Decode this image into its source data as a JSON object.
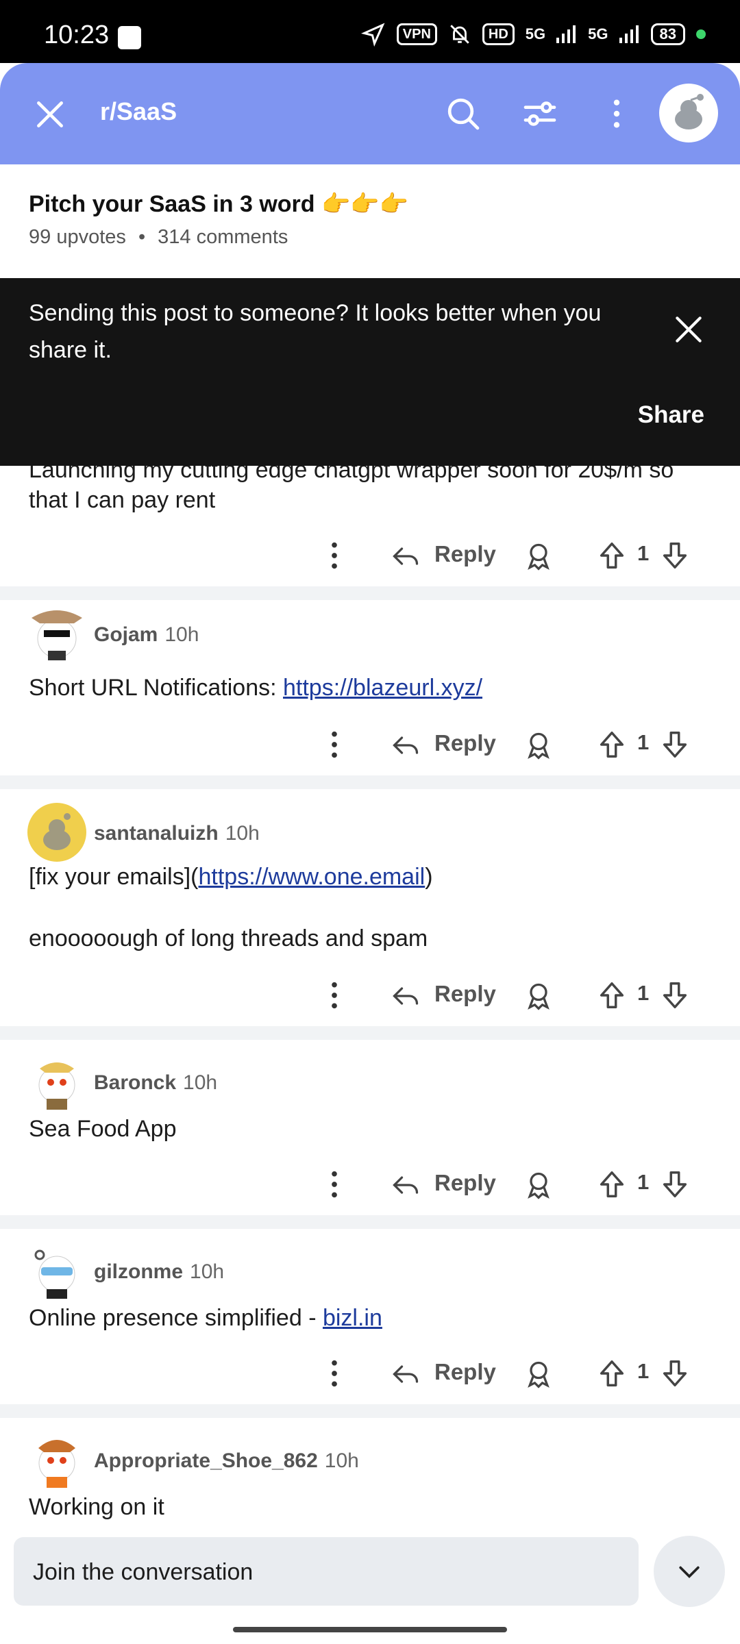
{
  "status_bar": {
    "time": "10:23",
    "vpn": "VPN",
    "hd": "HD",
    "net1": "5G",
    "net2": "5G",
    "battery": "83"
  },
  "header": {
    "subreddit": "r/SaaS"
  },
  "post": {
    "title": "Pitch your SaaS in 3 word 👉👉👉",
    "upvotes": "99 upvotes",
    "separator": "•",
    "comments": "314 comments"
  },
  "toast": {
    "message": "Sending this post to someone? It looks better when you share it.",
    "action": "Share"
  },
  "comments": [
    {
      "text": "Launching my cutting edge chatgpt wrapper soon for 20$/m so that I can pay rent",
      "reply": "Reply",
      "votes": "1"
    },
    {
      "author": "Gojam",
      "time": "10h",
      "text_prefix": "Short URL Notifications: ",
      "link": "https://blazeurl.xyz/",
      "reply": "Reply",
      "votes": "1"
    },
    {
      "author": "santanaluizh",
      "time": "10h",
      "text_prefix": "[fix your emails](",
      "link": "https://www.one.email",
      "text_suffix": ")",
      "text_line2": "enooooough of long threads and spam",
      "reply": "Reply",
      "votes": "1"
    },
    {
      "author": "Baronck",
      "time": "10h",
      "text": "Sea Food App",
      "reply": "Reply",
      "votes": "1"
    },
    {
      "author": "gilzonme",
      "time": "10h",
      "text_prefix": "Online presence simplified - ",
      "link": "bizl.in",
      "reply": "Reply",
      "votes": "1"
    },
    {
      "author": "Appropriate_Shoe_862",
      "time": "10h",
      "text": "Working on it"
    }
  ],
  "bottom": {
    "placeholder": "Join the conversation"
  },
  "colors": {
    "appbar": "#7f95f1",
    "toast_bg": "#141414",
    "link": "#1d3b9c"
  }
}
